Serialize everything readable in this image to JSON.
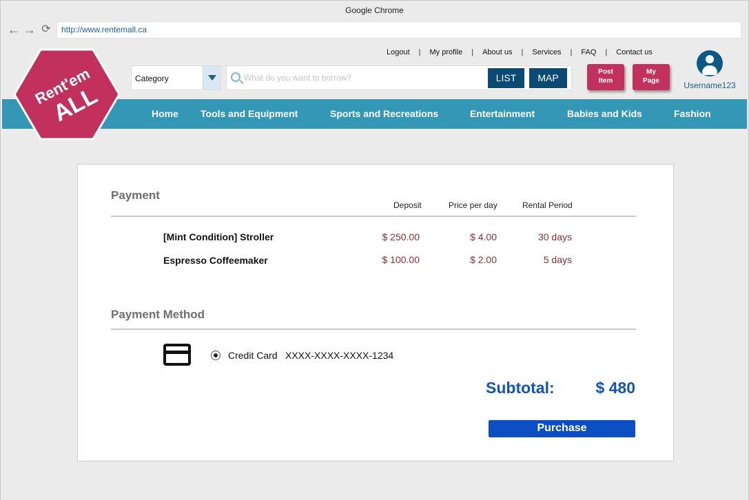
{
  "browser": {
    "title": "Google Chrome",
    "url": "http://www.rentemall.ca"
  },
  "header": {
    "logo_line1": "Rent'em",
    "logo_line2": "ALL",
    "brand_color": "#c2305e",
    "top_links": [
      "Logout",
      "My profile",
      "About us",
      "Services",
      "FAQ",
      "Contact us"
    ],
    "category_label": "Category",
    "search_placeholder": "What do you want to borrow?",
    "list_label": "LIST",
    "map_label": "MAP",
    "post_item_line1": "Post",
    "post_item_line2": "Item",
    "my_page_line1": "My",
    "my_page_line2": "Page",
    "username": "Username123"
  },
  "nav": {
    "color": "#3397b5",
    "items": [
      "Home",
      "Tools and Equipment",
      "Sports and Recreations",
      "Entertainment",
      "Babies and Kids",
      "Fashion"
    ]
  },
  "payment": {
    "title": "Payment",
    "columns": [
      "Deposit",
      "Price per day",
      "Rental Period"
    ],
    "items": [
      {
        "name": "[Mint Condition] Stroller",
        "deposit": "$ 250.00",
        "price": "$ 4.00",
        "period": "30 days"
      },
      {
        "name": "Espresso Coffeemaker",
        "deposit": "$ 100.00",
        "price": "$ 2.00",
        "period": "5 days"
      }
    ]
  },
  "payment_method": {
    "title": "Payment Method",
    "selected": "Credit Card",
    "card_number": "XXXX-XXXX-XXXX-1234"
  },
  "summary": {
    "subtotal_label": "Subtotal:",
    "subtotal_value": "$ 480",
    "purchase_label": "Purchase"
  }
}
